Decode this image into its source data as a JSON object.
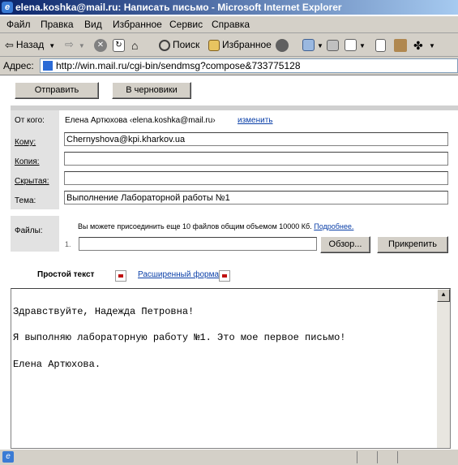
{
  "window": {
    "title": "elena.koshka@mail.ru: Написать письмо - Microsoft Internet Explorer"
  },
  "menu": [
    "Файл",
    "Правка",
    "Вид",
    "Избранное",
    "Сервис",
    "Справка"
  ],
  "toolbar": {
    "back": "Назад",
    "search": "Поиск",
    "favorites": "Избранное"
  },
  "address": {
    "label": "Адрес:",
    "url": "http://win.mail.ru/cgi-bin/sendmsg?compose&733775128"
  },
  "actions": {
    "send": "Отправить",
    "draft": "В черновики"
  },
  "form": {
    "from_label": "От кого:",
    "from_value": "Елена Артюхова  ‹elena.koshka@mail.ru›",
    "change_link": "изменить",
    "to_label": "Кому:",
    "to_value": "Chernyshova@kpi.kharkov.ua",
    "cc_label": "Копия:",
    "cc_value": "",
    "bcc_label": "Скрытая:",
    "bcc_value": "",
    "subject_label": "Тема:",
    "subject_value": "Выполнение Лабораторной работы №1"
  },
  "files": {
    "label": "Файлы:",
    "hint": "Вы можете присоединить еще 10 файлов общим объемом 10000 Кб.",
    "more_link": "Подробнее.",
    "index": "1.",
    "browse": "Обзор...",
    "attach": "Прикрепить"
  },
  "tabs": {
    "plain": "Простой текст",
    "rich": "Расширенный формат"
  },
  "body": [
    "Здравствуйте, Надежда Петровна!",
    "Я выполняю лабораторную работу №1. Это мое первое письмо!",
    "Елена Артюхова."
  ]
}
